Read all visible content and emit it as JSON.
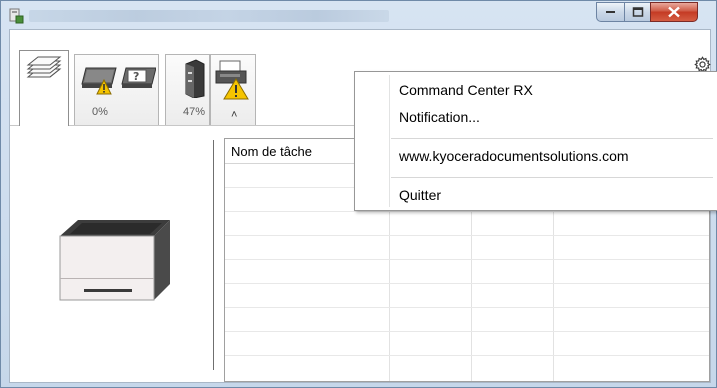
{
  "window": {
    "title": "",
    "buttons": {
      "minimize": "minimize",
      "maximize": "maximize",
      "close": "close"
    }
  },
  "tabs": {
    "tray_percent": "0%",
    "toner_percent": "47%"
  },
  "grid": {
    "columns": [
      "Nom de tâche",
      "",
      "",
      ""
    ]
  },
  "context_menu": {
    "items": [
      {
        "label": "Command Center RX"
      },
      {
        "label": "Notification..."
      },
      {
        "label": "www.kyoceradocumentsolutions.com"
      },
      {
        "label": "Quitter"
      }
    ]
  },
  "icons": {
    "app": "printer-app-icon",
    "gear": "gear-icon",
    "collapse": "chevron-up-icon"
  },
  "colors": {
    "warning": "#f5c400",
    "close_button": "#c94a35"
  }
}
